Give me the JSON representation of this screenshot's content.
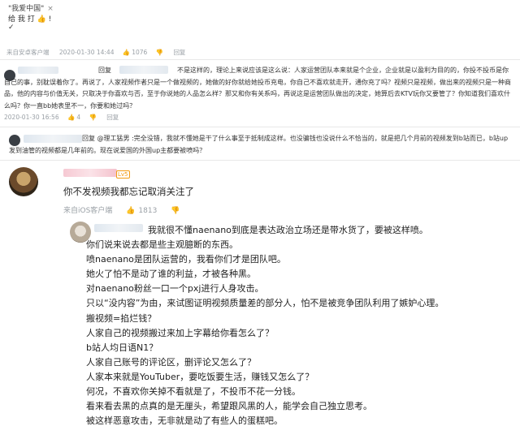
{
  "top_comment": {
    "line1": "\"我爱中国\"",
    "close_mark": "×",
    "line2": "给 我 打 👍 !",
    "line2_suffix": "✓",
    "source": "来自安卓客户端",
    "date": "2020-01-30 14:44",
    "likes": "1076"
  },
  "comment1": {
    "reply_label": "回复",
    "text": "不是这样的，理论上来说应该是这么说：人家运营团队本来就是个企业，企业就是以盈利为目的的，你投不投币是你自己的事，别耽误着你了。再说了，人家视频作者只是一个做视频的，她做的好你就给她投币充电，你自己不喜欢就走开，通你充了吗？视频只是视频，做出来的视频只是一种商品，他的内容与价值无关，只取决于你喜欢与否，至于你说她的人品怎么样？那又和你有关系吗，再说这是运营团队做出的决定，她算后去KTV玩你又要管了？你知道我们喜欢什么吗？你一直bb她表里不一，你要和她过吗？",
    "date": "2020-01-30 16:56",
    "likes": "4"
  },
  "comment2": {
    "text": "回复 @理工猛男 :完全没错，我就不懂她是干了什么事至于抵制成这样。也没骗钱也没说什么不恰当的，就是把几个月前的视频发到b站而已，b站up发到油管的视频都是几年前的。现在说爱国的外国up主都要被喷吗？"
  },
  "main_comment": {
    "level": "Lv5",
    "text": "你不发视频我都忘记取消关注了",
    "source": "来自iOS客户端",
    "likes": "1813"
  },
  "reply": {
    "lines": [
      "我就很不懂naenano到底是表达政治立场还是带水货了，要被这样喷。",
      "你们说来说去都是些主观臆断的东西。",
      "喷naenano是团队运营的，我看你们才是团队吧。",
      "她火了怕不是动了谁的利益，才被各种黑。",
      "对naenano粉丝一口一个pxj进行人身攻击。",
      "只以“没内容”为由，来试图证明视频质量差的部分人，怕不是被竞争团队利用了嫉妒心理。",
      "搬视频=掐烂钱？",
      "人家自己的视频搬过来加上字幕给你看怎么了？",
      "b站人均日语N1？",
      "人家自己账号的评论区，删评论又怎么了？",
      "人家本来就是YouTuber，要吃饭要生活，赚钱又怎么了？",
      "何况，不喜欢你关掉不看就是了，不投币不花一分钱。",
      "看来看去黑的点真的是无厘头，希望跟风黑的人，能学会自己独立思考。",
      "被这样恶意攻击，无非就是动了有些人的蛋糕吧。"
    ]
  },
  "icons": [
    "thumb-up-icon",
    "thumb-down-icon",
    "reply-icon"
  ],
  "colors": {
    "meta_gray": "#9aa0a6",
    "level_badge": "#f39c12",
    "name_blur_pink": "#f6c9d3",
    "name_blur_blue": "#dfe7ef"
  }
}
